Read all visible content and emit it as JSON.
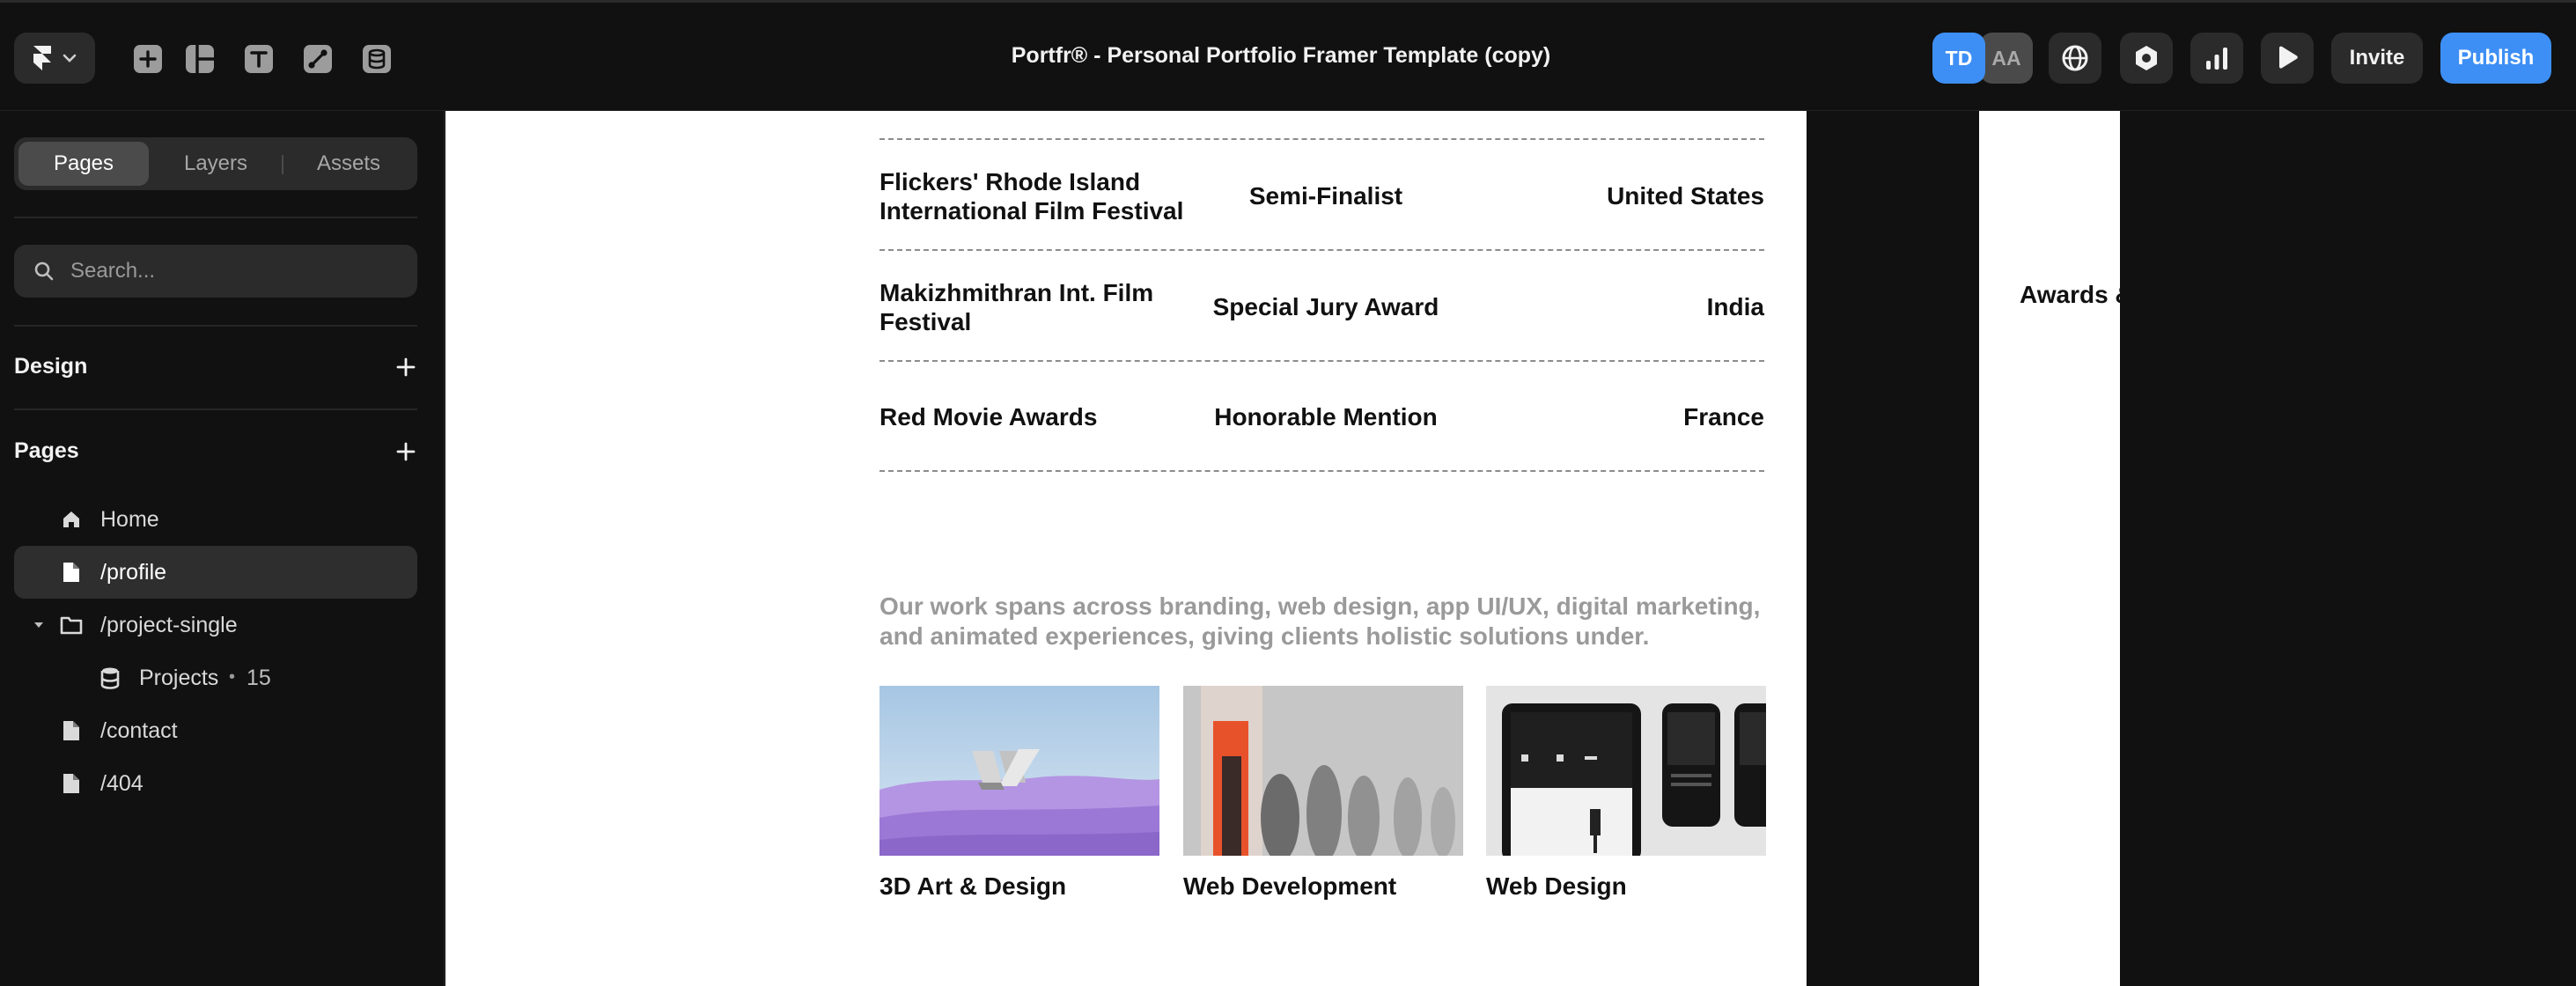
{
  "topbar": {
    "document_title": "Portfr® - Personal Portfolio Framer Template (copy)",
    "tools": [
      "insert-icon",
      "layout-icon",
      "text-icon",
      "vector-icon",
      "cms-icon"
    ],
    "collaborators": [
      {
        "initials": "TD",
        "color": "#3d8ff5"
      },
      {
        "initials": "AA",
        "color": "#4a4a4a"
      }
    ],
    "invite_label": "Invite",
    "publish_label": "Publish"
  },
  "sidebar": {
    "tabs": [
      {
        "label": "Pages",
        "active": true
      },
      {
        "label": "Layers",
        "active": false
      },
      {
        "label": "Assets",
        "active": false
      }
    ],
    "search": {
      "placeholder": "Search..."
    },
    "design_section": {
      "title": "Design"
    },
    "pages_section": {
      "title": "Pages",
      "items": [
        {
          "label": "Home",
          "icon": "home-icon",
          "active": false
        },
        {
          "label": "/profile",
          "icon": "page-icon",
          "active": true
        },
        {
          "label": "/project-single",
          "icon": "folder-icon",
          "active": false,
          "expanded": true
        },
        {
          "label": "Projects",
          "separator": "•",
          "count": "15",
          "icon": "database-icon",
          "active": false
        },
        {
          "label": "/contact",
          "icon": "page-icon",
          "active": false
        },
        {
          "label": "/404",
          "icon": "page-icon",
          "active": false
        }
      ]
    }
  },
  "canvas": {
    "awards": [
      {
        "event": "Flickers' Rhode Island International Film Festival",
        "award": "Semi-Finalist",
        "country": "United States"
      },
      {
        "event": "Makizhmithran Int. Film Festival",
        "award": "Special Jury Award",
        "country": "India"
      },
      {
        "event": "Red Movie Awards",
        "award": "Honorable Mention",
        "country": "France"
      }
    ],
    "intro": "Our work spans across branding, web design, app UI/UX, digital marketing, and animated experiences, giving clients holistic solutions under.",
    "services": [
      {
        "label": "3D Art & Design"
      },
      {
        "label": "Web Development"
      },
      {
        "label": "Web Design"
      }
    ],
    "adjacent_frame_heading": "Awards &"
  },
  "colors": {
    "accent": "#3d8ff5",
    "ui_background": "#111111",
    "control_background": "#2b2b2b",
    "canvas_page": "#ffffff",
    "muted_text": "#9a9a9a"
  }
}
